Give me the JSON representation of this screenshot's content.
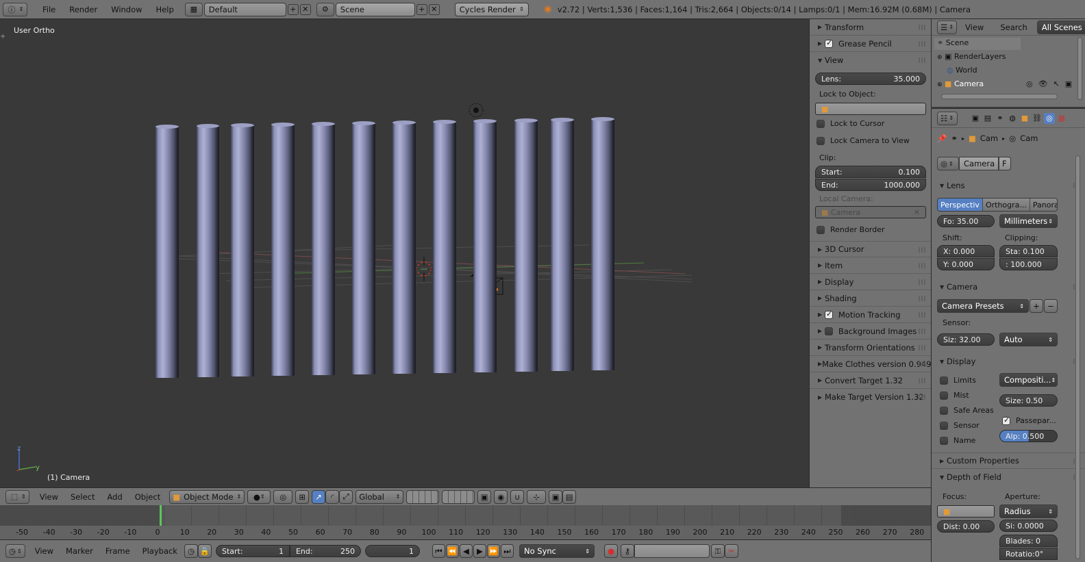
{
  "topbar": {
    "menu": [
      "File",
      "Render",
      "Window",
      "Help"
    ],
    "layout": "Default",
    "scene": "Scene",
    "engine": "Cycles Render",
    "stats": "v2.72 | Verts:1,536 | Faces:1,164 | Tris:2,664 | Objects:0/14 | Lamps:0/1 | Mem:16.92M (0.68M) | Camera"
  },
  "viewport": {
    "view_label": "User Ortho",
    "object_label": "(1) Camera",
    "axis_z": "z",
    "axis_y": "y"
  },
  "view_header": {
    "menu": [
      "View",
      "Select",
      "Add",
      "Object"
    ],
    "mode": "Object Mode",
    "orientation": "Global"
  },
  "npanel": {
    "panels_top": [
      "Transform",
      "Grease Pencil",
      "View"
    ],
    "lens_label": "Lens:",
    "lens_value": "35.000",
    "lock_object": "Lock to Object:",
    "lock_cursor": "Lock to Cursor",
    "lock_camera": "Lock Camera to View",
    "clip": "Clip:",
    "clip_start_label": "Start:",
    "clip_start": "0.100",
    "clip_end_label": "End:",
    "clip_end": "1000.000",
    "local_camera": "Local Camera:",
    "local_camera_value": "Camera",
    "render_border": "Render Border",
    "panels_bottom": [
      "3D Cursor",
      "Item",
      "Display",
      "Shading",
      "Motion Tracking",
      "Background Images",
      "Transform Orientations",
      "Make Clothes version 0.949",
      "Convert Target 1.32",
      "Make Target  Version 1.32"
    ]
  },
  "outliner": {
    "menu": [
      "View",
      "Search"
    ],
    "filter": "All Scenes",
    "items": [
      "Scene",
      "RenderLayers",
      "World",
      "Camera"
    ]
  },
  "properties": {
    "breadcrumb": [
      "Cam",
      "Cam"
    ],
    "datablock": "Camera",
    "fake_user": "F",
    "lens_panel": "Lens",
    "lens_types": [
      "Perspectiv",
      "Orthogra...",
      "Panoramic"
    ],
    "focal": "Fo: 35.00",
    "units": "Millimeters",
    "shift": "Shift:",
    "clipping": "Clipping:",
    "shift_x": "X:  0.000",
    "shift_y": "Y:  0.000",
    "clip_sta": "Sta: 0.100",
    "clip_end": ": 100.000",
    "camera_panel": "Camera",
    "presets": "Camera Presets",
    "sensor": "Sensor:",
    "sensor_size": "Siz: 32.00",
    "sensor_fit": "Auto",
    "display_panel": "Display",
    "limits": "Limits",
    "mist": "Mist",
    "safe_areas": "Safe Areas",
    "sensor_chk": "Sensor",
    "name_chk": "Name",
    "composition": "Compositi...",
    "size": "Size:  0.50",
    "passepartout": "Passepar...",
    "alpha": "Alp: 0.500",
    "custom_props": "Custom Properties",
    "dof_panel": "Depth of Field",
    "focus": "Focus:",
    "aperture": "Aperture:",
    "aperture_type": "Radius",
    "dist": "Dist:  0.00",
    "size2": "Si: 0.0000",
    "blades": "Blades:  0",
    "rotation": "Rotatio:0°"
  },
  "timeline": {
    "ticks": [
      "-50",
      "-40",
      "-30",
      "-20",
      "-10",
      "0",
      "10",
      "20",
      "30",
      "40",
      "50",
      "60",
      "70",
      "80",
      "90",
      "100",
      "110",
      "120",
      "130",
      "140",
      "150",
      "160",
      "170",
      "180",
      "190",
      "200",
      "210",
      "220",
      "230",
      "240",
      "250",
      "260",
      "270",
      "280"
    ],
    "menu": [
      "View",
      "Marker",
      "Frame",
      "Playback"
    ],
    "start_label": "Start:",
    "start": "1",
    "end_label": "End:",
    "end": "250",
    "current": "1",
    "sync": "No Sync"
  }
}
